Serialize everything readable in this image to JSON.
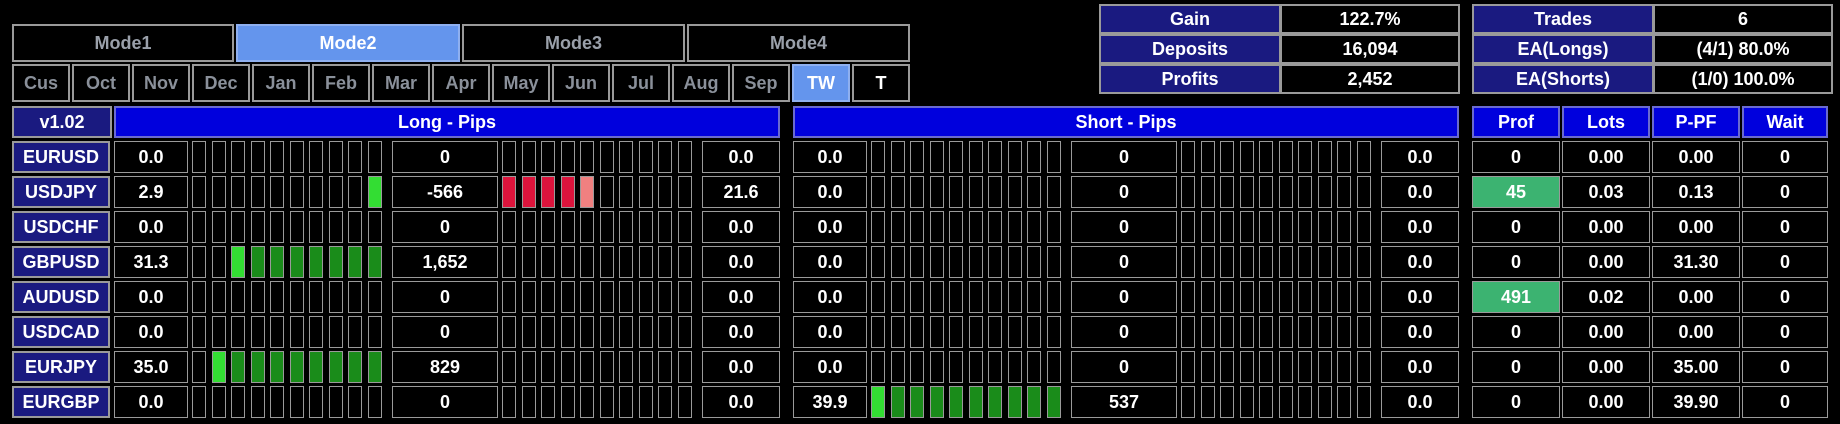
{
  "modes": [
    {
      "label": "Mode1",
      "active": false
    },
    {
      "label": "Mode2",
      "active": true
    },
    {
      "label": "Mode3",
      "active": false
    },
    {
      "label": "Mode4",
      "active": false
    }
  ],
  "months": [
    {
      "label": "Cus",
      "state": ""
    },
    {
      "label": "Oct",
      "state": ""
    },
    {
      "label": "Nov",
      "state": ""
    },
    {
      "label": "Dec",
      "state": ""
    },
    {
      "label": "Jan",
      "state": ""
    },
    {
      "label": "Feb",
      "state": ""
    },
    {
      "label": "Mar",
      "state": ""
    },
    {
      "label": "Apr",
      "state": ""
    },
    {
      "label": "May",
      "state": ""
    },
    {
      "label": "Jun",
      "state": ""
    },
    {
      "label": "Jul",
      "state": ""
    },
    {
      "label": "Aug",
      "state": ""
    },
    {
      "label": "Sep",
      "state": ""
    },
    {
      "label": "TW",
      "state": "active"
    },
    {
      "label": "T",
      "state": "white"
    }
  ],
  "stats_left": [
    {
      "label": "Gain",
      "value": "122.7%"
    },
    {
      "label": "Deposits",
      "value": "16,094"
    },
    {
      "label": "Profits",
      "value": "2,452"
    }
  ],
  "stats_right": [
    {
      "label": "Trades",
      "value": "6"
    },
    {
      "label": "EA(Longs)",
      "value": "(4/1) 80.0%"
    },
    {
      "label": "EA(Shorts)",
      "value": "(1/0) 100.0%"
    }
  ],
  "version": "v1.02",
  "long_header": "Long - Pips",
  "short_header": "Short - Pips",
  "right_headers": [
    "Prof",
    "Lots",
    "P-PF",
    "Wait"
  ],
  "colors": {
    "bar_green": "#1a8c1a",
    "bar_green_light": "#33dd33",
    "bar_red": "#dc143c",
    "bar_red_light": "#f08080",
    "prof_highlight": "#3cb371",
    "header_blue": "#0000dd",
    "label_navy": "#1a1a80",
    "active_tab": "#6495ed"
  },
  "rows": [
    {
      "symbol": "EURUSD",
      "long_a": "0.0",
      "long_mid": "0",
      "long_b": "0.0",
      "long_bars_left": "..........",
      "long_bars_right": "..........",
      "short_a": "0.0",
      "short_mid": "0",
      "short_b": "0.0",
      "short_bars_left": "..........",
      "short_bars_right": "..........",
      "prof": "0",
      "prof_highlight": false,
      "lots": "0.00",
      "ppf": "0.00",
      "wait": "0"
    },
    {
      "symbol": "USDJPY",
      "long_a": "2.9",
      "long_mid": "-566",
      "long_b": "21.6",
      "long_bars_left": ".........L",
      "long_bars_right": "RRRRr.....",
      "short_a": "0.0",
      "short_mid": "0",
      "short_b": "0.0",
      "short_bars_left": "..........",
      "short_bars_right": "..........",
      "prof": "45",
      "prof_highlight": true,
      "lots": "0.03",
      "ppf": "0.13",
      "wait": "0"
    },
    {
      "symbol": "USDCHF",
      "long_a": "0.0",
      "long_mid": "0",
      "long_b": "0.0",
      "long_bars_left": "..........",
      "long_bars_right": "..........",
      "short_a": "0.0",
      "short_mid": "0",
      "short_b": "0.0",
      "short_bars_left": "..........",
      "short_bars_right": "..........",
      "prof": "0",
      "prof_highlight": false,
      "lots": "0.00",
      "ppf": "0.00",
      "wait": "0"
    },
    {
      "symbol": "GBPUSD",
      "long_a": "31.3",
      "long_mid": "1,652",
      "long_b": "0.0",
      "long_bars_left": "..LGGGGGGG",
      "long_bars_right": "..........",
      "short_a": "0.0",
      "short_mid": "0",
      "short_b": "0.0",
      "short_bars_left": "..........",
      "short_bars_right": "..........",
      "prof": "0",
      "prof_highlight": false,
      "lots": "0.00",
      "ppf": "31.30",
      "wait": "0"
    },
    {
      "symbol": "AUDUSD",
      "long_a": "0.0",
      "long_mid": "0",
      "long_b": "0.0",
      "long_bars_left": "..........",
      "long_bars_right": "..........",
      "short_a": "0.0",
      "short_mid": "0",
      "short_b": "0.0",
      "short_bars_left": "..........",
      "short_bars_right": "..........",
      "prof": "491",
      "prof_highlight": true,
      "lots": "0.02",
      "ppf": "0.00",
      "wait": "0"
    },
    {
      "symbol": "USDCAD",
      "long_a": "0.0",
      "long_mid": "0",
      "long_b": "0.0",
      "long_bars_left": "..........",
      "long_bars_right": "..........",
      "short_a": "0.0",
      "short_mid": "0",
      "short_b": "0.0",
      "short_bars_left": "..........",
      "short_bars_right": "..........",
      "prof": "0",
      "prof_highlight": false,
      "lots": "0.00",
      "ppf": "0.00",
      "wait": "0"
    },
    {
      "symbol": "EURJPY",
      "long_a": "35.0",
      "long_mid": "829",
      "long_b": "0.0",
      "long_bars_left": ".LGGGGGGGG",
      "long_bars_right": "..........",
      "short_a": "0.0",
      "short_mid": "0",
      "short_b": "0.0",
      "short_bars_left": "..........",
      "short_bars_right": "..........",
      "prof": "0",
      "prof_highlight": false,
      "lots": "0.00",
      "ppf": "35.00",
      "wait": "0"
    },
    {
      "symbol": "EURGBP",
      "long_a": "0.0",
      "long_mid": "0",
      "long_b": "0.0",
      "long_bars_left": "..........",
      "long_bars_right": "..........",
      "short_a": "39.9",
      "short_mid": "537",
      "short_b": "0.0",
      "short_bars_left": "LGGGGGGGGG",
      "short_bars_right": "..........",
      "prof": "0",
      "prof_highlight": false,
      "lots": "0.00",
      "ppf": "39.90",
      "wait": "0"
    }
  ]
}
